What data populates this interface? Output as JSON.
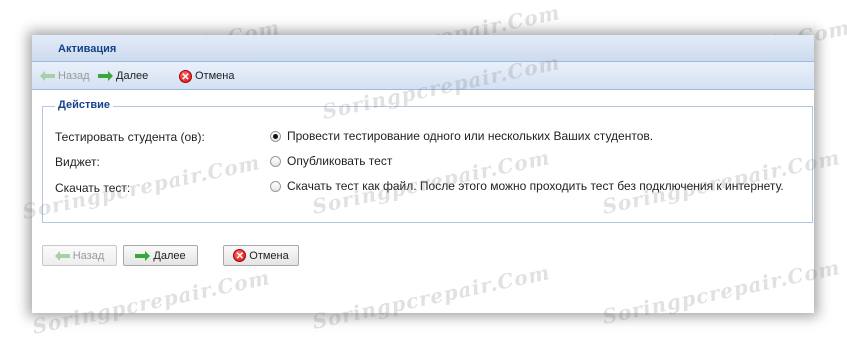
{
  "window": {
    "title": "Активация"
  },
  "toolbar": {
    "back_label": "Назад",
    "next_label": "Далее",
    "cancel_label": "Отмена"
  },
  "action": {
    "legend": "Действие",
    "rows": [
      {
        "label": "Тестировать студента (ов):",
        "option": "Провести тестирование одного или нескольких Ваших студентов.",
        "checked": true
      },
      {
        "label": "Виджет:",
        "option": "Опубликовать тест",
        "checked": false
      },
      {
        "label": "Скачать тест:",
        "option": "Скачать тест как файл. После этого можно проходить тест без подключения к интернету.",
        "checked": false
      }
    ]
  },
  "footer": {
    "back_label": "Назад",
    "next_label": "Далее",
    "cancel_label": "Отмена"
  },
  "watermark": "Soringpcrepair.Com",
  "colors": {
    "title_text": "#15428b",
    "header_bg": "#d4e1f2",
    "cancel_red": "#d11010",
    "arrow_green": "#3aa53a"
  }
}
